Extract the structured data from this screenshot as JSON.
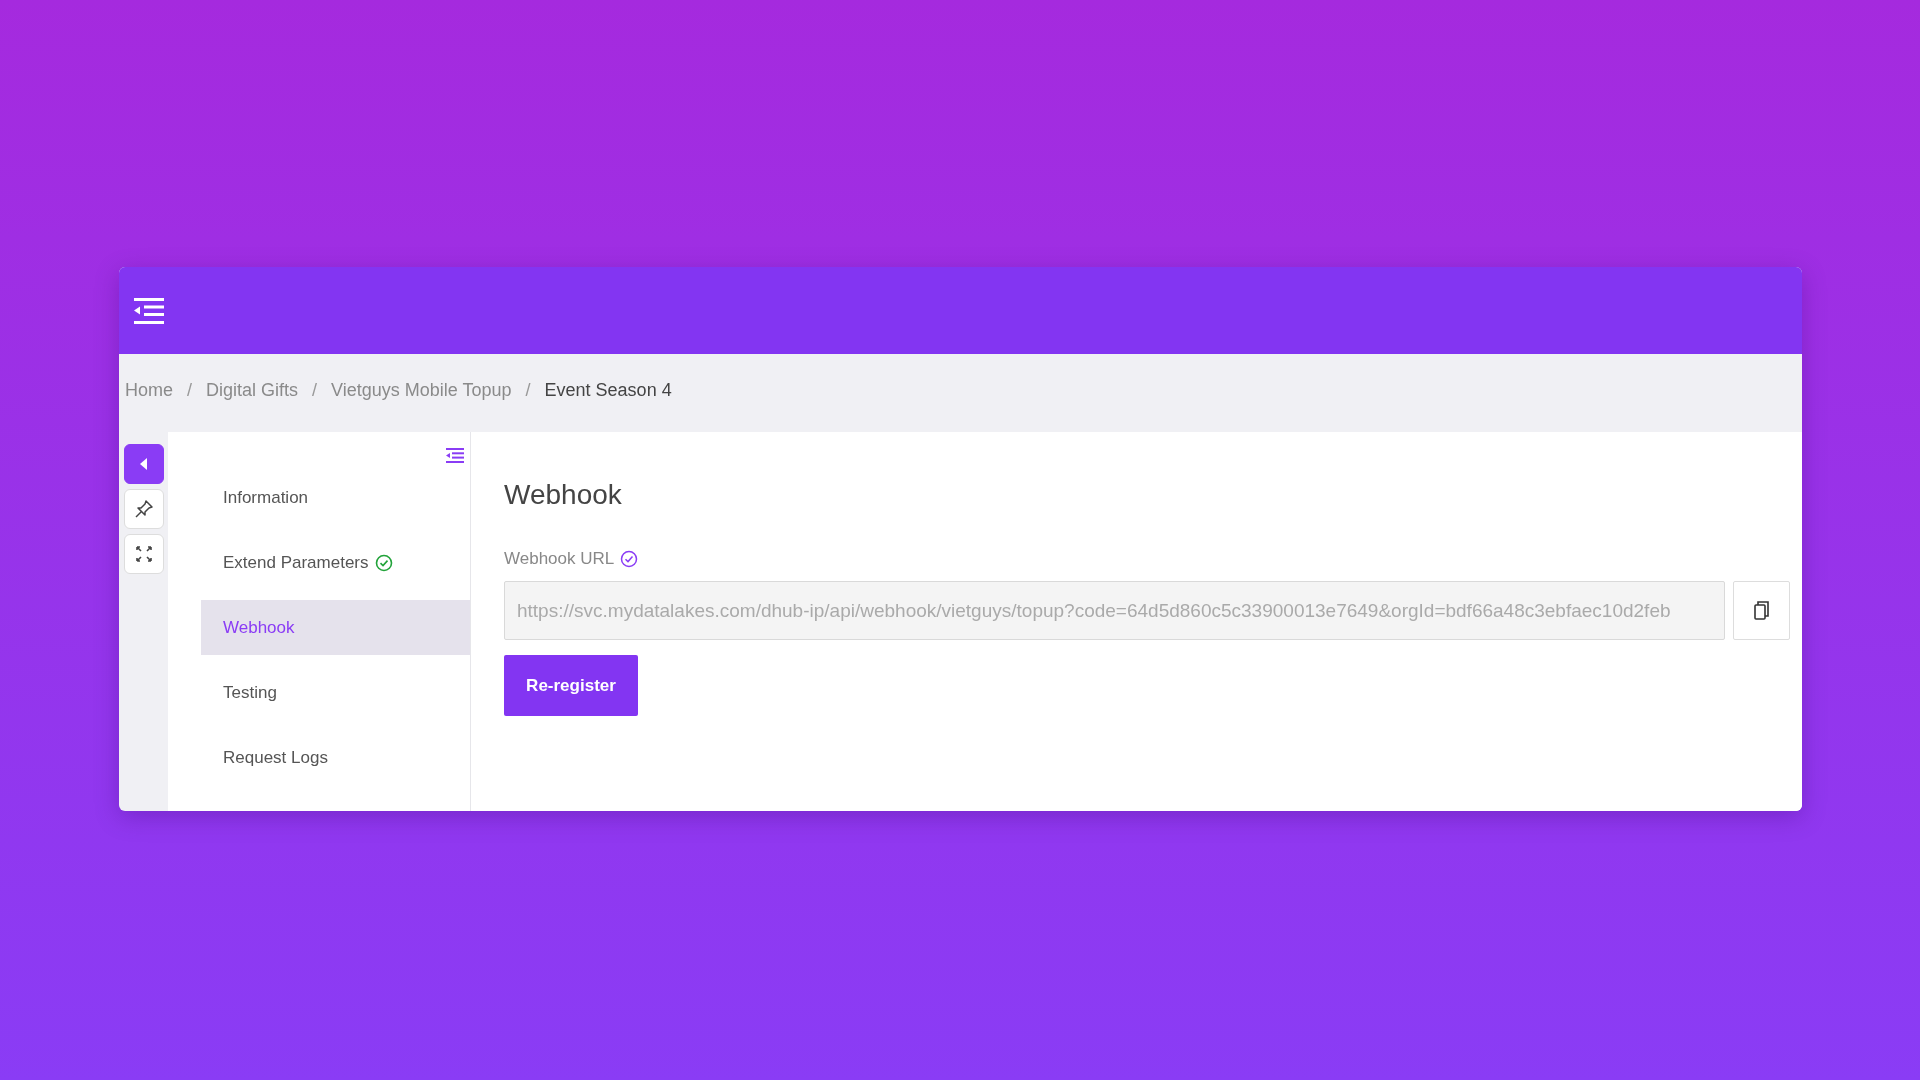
{
  "breadcrumb": [
    {
      "label": "Home",
      "current": false
    },
    {
      "separator": "/",
      "label": "Digital Gifts",
      "current": false
    },
    {
      "separator": "/",
      "label": "Vietguys Mobile Topup",
      "current": false
    },
    {
      "separator": "/",
      "label": "Event Season 4",
      "current": true
    }
  ],
  "rail": [
    {
      "kind": "collapse",
      "active": true
    },
    {
      "kind": "pin",
      "active": false
    },
    {
      "kind": "fullscreen",
      "active": false
    }
  ],
  "nav": [
    {
      "label": "Information",
      "selected": false,
      "verified": false
    },
    {
      "label": "Extend Parameters",
      "selected": false,
      "verified": true
    },
    {
      "label": "Webhook",
      "selected": true,
      "verified": false
    },
    {
      "label": "Testing",
      "selected": false,
      "verified": false
    },
    {
      "label": "Request Logs",
      "selected": false,
      "verified": false
    }
  ],
  "content": {
    "title": "Webhook",
    "field": {
      "label": "Webhook URL",
      "verified": true,
      "value": "https://svc.mydatalakes.com/dhub-ip/api/webhook/vietguys/topup?code=64d5d860c5c33900013e7649&orgId=bdf66a48c3ebfaec10d2feb"
    },
    "button": "Re-register"
  }
}
